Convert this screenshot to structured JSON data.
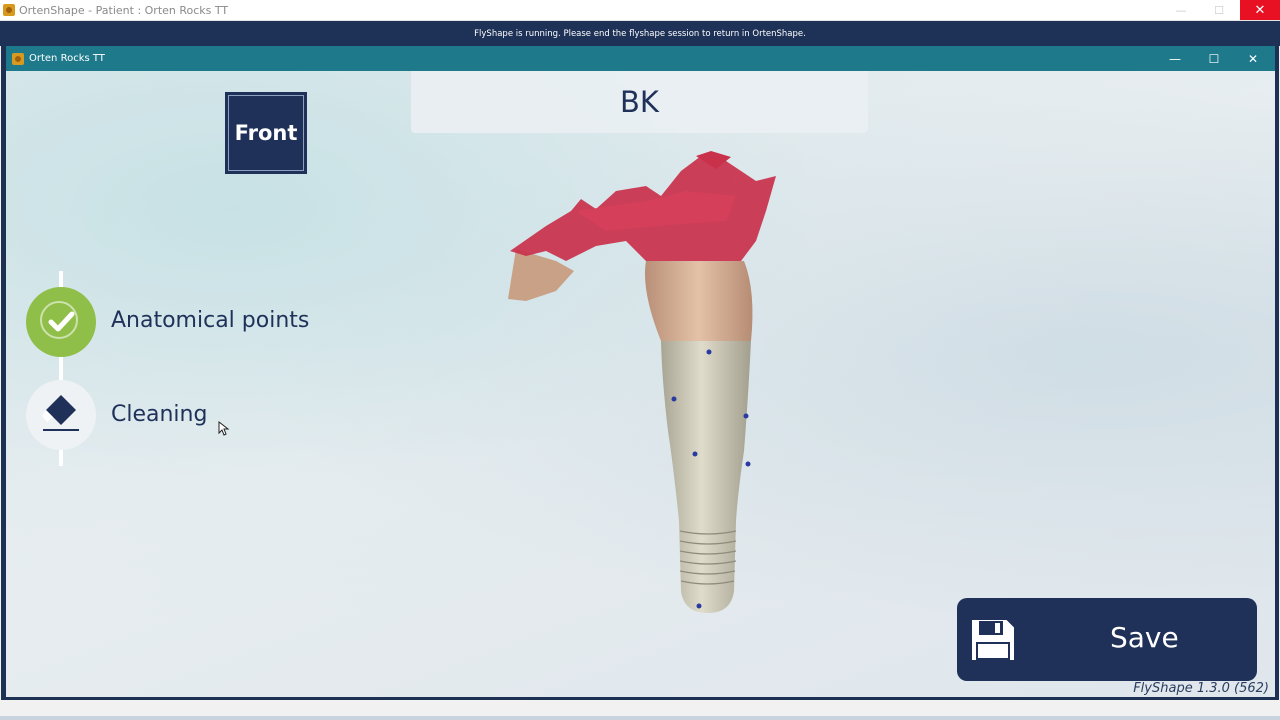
{
  "outer_window": {
    "title": "OrtenShape - Patient : Orten Rocks TT",
    "minimize_glyph": "—",
    "maximize_glyph": "☐",
    "close_glyph": "✕"
  },
  "banner": {
    "text": "FlyShape is running. Please end the flyshape session to return in OrtenShape."
  },
  "inner_window": {
    "title": "Orten Rocks TT",
    "minimize_glyph": "—",
    "maximize_glyph": "☐",
    "close_glyph": "✕"
  },
  "view": {
    "button_label": "Front",
    "model_label": "BK"
  },
  "steps": [
    {
      "label": "Anatomical points",
      "status": "complete",
      "icon": "checkmark-icon"
    },
    {
      "label": "Cleaning",
      "status": "active",
      "icon": "diamond-eraser-icon"
    }
  ],
  "save": {
    "label": "Save",
    "icon": "floppy-disk-icon"
  },
  "version": "FlyShape 1.3.0 (562)",
  "colors": {
    "navy": "#1f3159",
    "teal_titlebar": "#1e7a8a",
    "step_complete": "#8fbf48",
    "close_red": "#e81123"
  }
}
